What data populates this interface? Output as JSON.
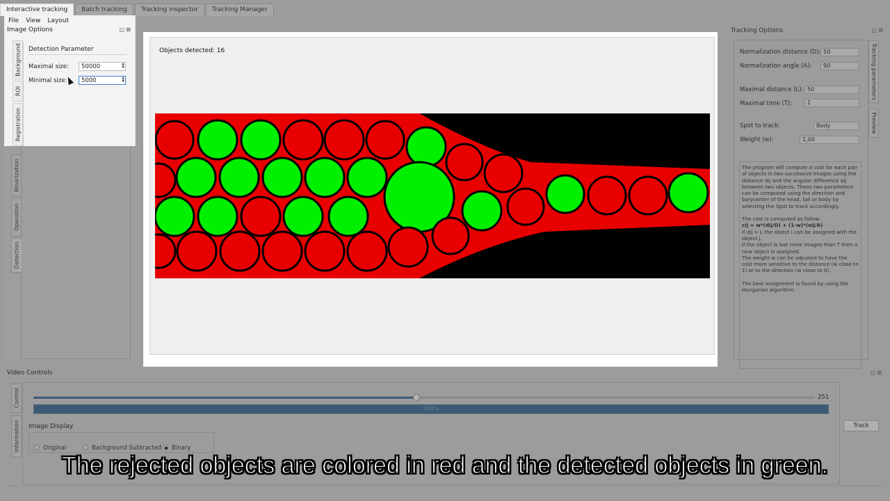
{
  "tabs": [
    "Interactive tracking",
    "Batch tracking",
    "Tracking inspector",
    "Tracking Manager"
  ],
  "menu": [
    "File",
    "View",
    "Layout"
  ],
  "image_options": {
    "title": "Image Options",
    "dock_buttons": "◱⊠",
    "vtabs": [
      "Background",
      "ROI",
      "Registration",
      "Binarization",
      "Operation",
      "Detection"
    ],
    "detection": {
      "title": "Detection Parameter",
      "max_label": "Maximal size:",
      "max_value": "50000",
      "min_label": "Minimal size:",
      "min_value": "5000"
    }
  },
  "viewport": {
    "objects_detected": "Objects detected: 16"
  },
  "tracking": {
    "title": "Tracking Options",
    "dock_buttons": "◱⊠",
    "vtabs": [
      "Tracking parameters",
      "Preview"
    ],
    "norm_dist_label": "Normalization distance (D):",
    "norm_dist_value": "50",
    "norm_angle_label": "Normalization angle (A):",
    "norm_angle_value": "90",
    "max_dist_label": "Maximal distance (L):",
    "max_dist_value": "50",
    "max_time_label": "Maximal time (T):",
    "max_time_value": "1",
    "spot_label": "Spot to track:",
    "spot_value": "Body",
    "weight_label": "Weight (w):",
    "weight_value": "1,00",
    "help": {
      "p1": "The program will compute a cost for each pair of objects in two successive images using the distance dij and the angular difference aij between two objects. These two parameters can be computed using the direction and barycenter of the head, tail or body by selecting the Spot to track accordingly.",
      "p2a": "The cost is computed as follow:",
      "p2b": "cij = w*(dij/D) + (1-w)*(aij/A)",
      "p2c": "if dij > L the object i can be assigned with the object j.",
      "p2d": "if the object is lost more images than T then a new object is assigned.",
      "p2e": "The weight w can be adjusted to have the cost more sensitive to the distance (w close to 1) or to the direction (w close to 0).",
      "p3": "The best assignment is found by using the Hungarian algorithm."
    }
  },
  "video": {
    "title": "Video Controls",
    "dock_buttons": "◱⊠",
    "vtabs": [
      "Control",
      "Information"
    ],
    "slider_max": "251",
    "slider_value": 123,
    "slider_range": [
      0,
      251
    ],
    "progress_text": "100%",
    "progress_value": 1.0,
    "image_display_title": "Image Display",
    "radio_original": "Original",
    "radio_bg": "Background Subtracted",
    "radio_binary": "Binary",
    "track_button": "Track"
  },
  "subtitle": "The rejected objects are colored in red and the detected objects in green.",
  "colors": {
    "rejected": "#e80000",
    "detected": "#00f000"
  }
}
